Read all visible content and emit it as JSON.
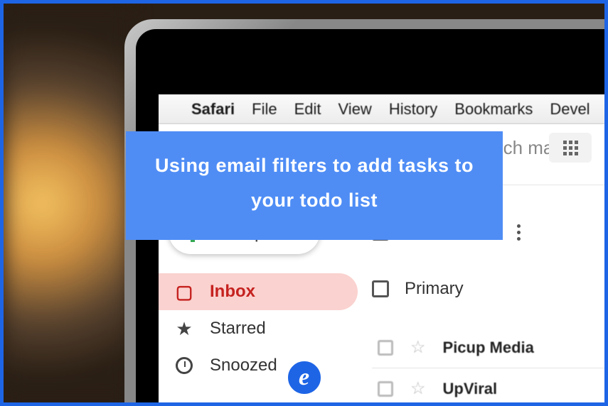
{
  "menu": {
    "app": "Safari",
    "items": [
      "File",
      "Edit",
      "View",
      "History",
      "Bookmarks",
      "Devel"
    ]
  },
  "search": {
    "placeholder": "earch mail"
  },
  "compose": {
    "label": "Compose"
  },
  "sidebar": {
    "inbox": "Inbox",
    "starred": "Starred",
    "snoozed": "Snoozed"
  },
  "tabs": {
    "primary": "Primary"
  },
  "mail": {
    "rows": [
      {
        "sender": "Picup Media"
      },
      {
        "sender": "UpViral"
      }
    ]
  },
  "overlay": {
    "title": "Using email filters to add tasks to your todo list"
  },
  "badge": {
    "letter": "e"
  }
}
